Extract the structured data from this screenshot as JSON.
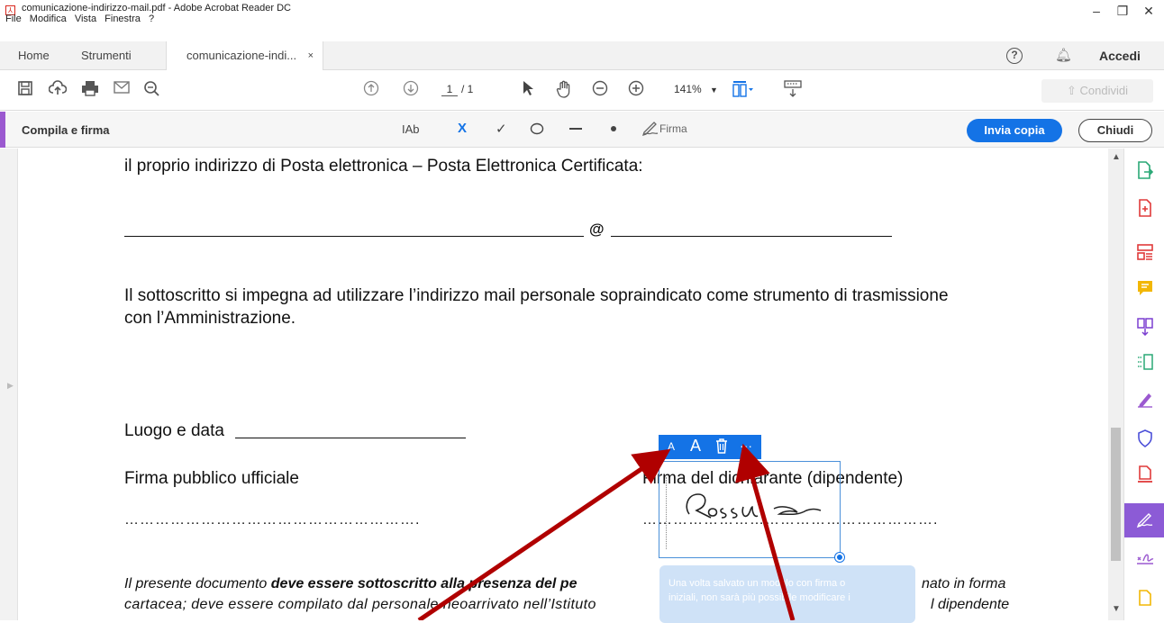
{
  "window": {
    "title": "comunicazione-indirizzo-mail.pdf - Adobe Acrobat Reader DC",
    "menu": [
      "File",
      "Modifica",
      "Vista",
      "Finestra",
      "?"
    ],
    "controls": {
      "minimize": "–",
      "restore": "❐",
      "close": "✕"
    }
  },
  "tabs": {
    "home": "Home",
    "tools": "Strumenti",
    "document": "comunicazione-indi...",
    "close": "×",
    "signin": "Accedi"
  },
  "toolbar": {
    "page_current": "1",
    "page_total": "/ 1",
    "zoom": "141%",
    "share": "Condividi"
  },
  "fill_sign": {
    "label": "Compila e firma",
    "text_tool": "IAb",
    "cross_tool": "X",
    "check_tool": "✓",
    "sign_tool": "Firma",
    "send_copy": "Invia copia",
    "close": "Chiudi"
  },
  "document": {
    "line1": "il proprio indirizzo di Posta elettronica – Posta Elettronica Certificata:",
    "at": "@",
    "para1_a": "Il sottoscritto si impegna ad utilizzare l’indirizzo mail personale sopraindicato come strumento di trasmissione",
    "para1_b": "con  l’Amministrazione.",
    "place_date": "Luogo e data",
    "firma_pubblico": "Firma pubblico ufficiale",
    "firma_dichiarante": "Firma del dichiarante (dipendente)",
    "dots_left": "………………………………………………….",
    "dots_right": "………………………………………………….",
    "italic1_a": "Il presente documento ",
    "italic1_b": "deve essere sottoscritto alla presenza del pe",
    "italic1_c": "nato in forma",
    "italic2_a": "cartacea; deve essere compilato dal personale neoarrivato nell’Istituto",
    "italic2_b": "l dipendente",
    "signature_text": "Rossi"
  },
  "signature_toolbar": {
    "small_a": "A",
    "large_a": "A",
    "delete": "🗑",
    "more": "···"
  },
  "tooltip": {
    "line1": "Una volta salvato un modulo con firma o",
    "line2": "iniziali, non sarà più possibile modificare i"
  },
  "colors": {
    "accent": "#1473e6",
    "purple": "#9b59d0",
    "arrow": "#b00000"
  }
}
